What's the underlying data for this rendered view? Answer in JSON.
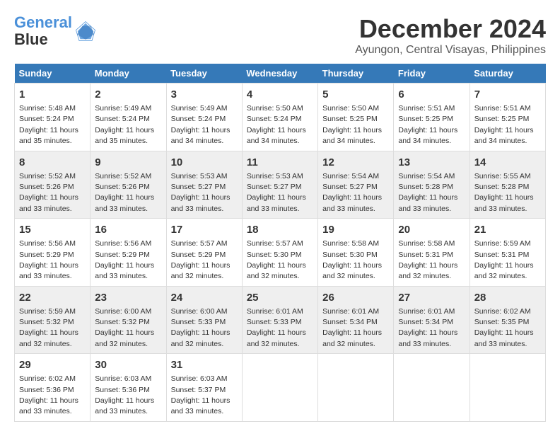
{
  "logo": {
    "line1": "General",
    "line2": "Blue"
  },
  "header": {
    "month": "December 2024",
    "location": "Ayungon, Central Visayas, Philippines"
  },
  "weekdays": [
    "Sunday",
    "Monday",
    "Tuesday",
    "Wednesday",
    "Thursday",
    "Friday",
    "Saturday"
  ],
  "rows": [
    [
      {
        "day": "1",
        "sunrise": "5:48 AM",
        "sunset": "5:24 PM",
        "daylight": "11 hours and 35 minutes."
      },
      {
        "day": "2",
        "sunrise": "5:49 AM",
        "sunset": "5:24 PM",
        "daylight": "11 hours and 35 minutes."
      },
      {
        "day": "3",
        "sunrise": "5:49 AM",
        "sunset": "5:24 PM",
        "daylight": "11 hours and 34 minutes."
      },
      {
        "day": "4",
        "sunrise": "5:50 AM",
        "sunset": "5:24 PM",
        "daylight": "11 hours and 34 minutes."
      },
      {
        "day": "5",
        "sunrise": "5:50 AM",
        "sunset": "5:25 PM",
        "daylight": "11 hours and 34 minutes."
      },
      {
        "day": "6",
        "sunrise": "5:51 AM",
        "sunset": "5:25 PM",
        "daylight": "11 hours and 34 minutes."
      },
      {
        "day": "7",
        "sunrise": "5:51 AM",
        "sunset": "5:25 PM",
        "daylight": "11 hours and 34 minutes."
      }
    ],
    [
      {
        "day": "8",
        "sunrise": "5:52 AM",
        "sunset": "5:26 PM",
        "daylight": "11 hours and 33 minutes."
      },
      {
        "day": "9",
        "sunrise": "5:52 AM",
        "sunset": "5:26 PM",
        "daylight": "11 hours and 33 minutes."
      },
      {
        "day": "10",
        "sunrise": "5:53 AM",
        "sunset": "5:27 PM",
        "daylight": "11 hours and 33 minutes."
      },
      {
        "day": "11",
        "sunrise": "5:53 AM",
        "sunset": "5:27 PM",
        "daylight": "11 hours and 33 minutes."
      },
      {
        "day": "12",
        "sunrise": "5:54 AM",
        "sunset": "5:27 PM",
        "daylight": "11 hours and 33 minutes."
      },
      {
        "day": "13",
        "sunrise": "5:54 AM",
        "sunset": "5:28 PM",
        "daylight": "11 hours and 33 minutes."
      },
      {
        "day": "14",
        "sunrise": "5:55 AM",
        "sunset": "5:28 PM",
        "daylight": "11 hours and 33 minutes."
      }
    ],
    [
      {
        "day": "15",
        "sunrise": "5:56 AM",
        "sunset": "5:29 PM",
        "daylight": "11 hours and 33 minutes."
      },
      {
        "day": "16",
        "sunrise": "5:56 AM",
        "sunset": "5:29 PM",
        "daylight": "11 hours and 33 minutes."
      },
      {
        "day": "17",
        "sunrise": "5:57 AM",
        "sunset": "5:29 PM",
        "daylight": "11 hours and 32 minutes."
      },
      {
        "day": "18",
        "sunrise": "5:57 AM",
        "sunset": "5:30 PM",
        "daylight": "11 hours and 32 minutes."
      },
      {
        "day": "19",
        "sunrise": "5:58 AM",
        "sunset": "5:30 PM",
        "daylight": "11 hours and 32 minutes."
      },
      {
        "day": "20",
        "sunrise": "5:58 AM",
        "sunset": "5:31 PM",
        "daylight": "11 hours and 32 minutes."
      },
      {
        "day": "21",
        "sunrise": "5:59 AM",
        "sunset": "5:31 PM",
        "daylight": "11 hours and 32 minutes."
      }
    ],
    [
      {
        "day": "22",
        "sunrise": "5:59 AM",
        "sunset": "5:32 PM",
        "daylight": "11 hours and 32 minutes."
      },
      {
        "day": "23",
        "sunrise": "6:00 AM",
        "sunset": "5:32 PM",
        "daylight": "11 hours and 32 minutes."
      },
      {
        "day": "24",
        "sunrise": "6:00 AM",
        "sunset": "5:33 PM",
        "daylight": "11 hours and 32 minutes."
      },
      {
        "day": "25",
        "sunrise": "6:01 AM",
        "sunset": "5:33 PM",
        "daylight": "11 hours and 32 minutes."
      },
      {
        "day": "26",
        "sunrise": "6:01 AM",
        "sunset": "5:34 PM",
        "daylight": "11 hours and 32 minutes."
      },
      {
        "day": "27",
        "sunrise": "6:01 AM",
        "sunset": "5:34 PM",
        "daylight": "11 hours and 33 minutes."
      },
      {
        "day": "28",
        "sunrise": "6:02 AM",
        "sunset": "5:35 PM",
        "daylight": "11 hours and 33 minutes."
      }
    ],
    [
      {
        "day": "29",
        "sunrise": "6:02 AM",
        "sunset": "5:36 PM",
        "daylight": "11 hours and 33 minutes."
      },
      {
        "day": "30",
        "sunrise": "6:03 AM",
        "sunset": "5:36 PM",
        "daylight": "11 hours and 33 minutes."
      },
      {
        "day": "31",
        "sunrise": "6:03 AM",
        "sunset": "5:37 PM",
        "daylight": "11 hours and 33 minutes."
      },
      null,
      null,
      null,
      null
    ]
  ]
}
